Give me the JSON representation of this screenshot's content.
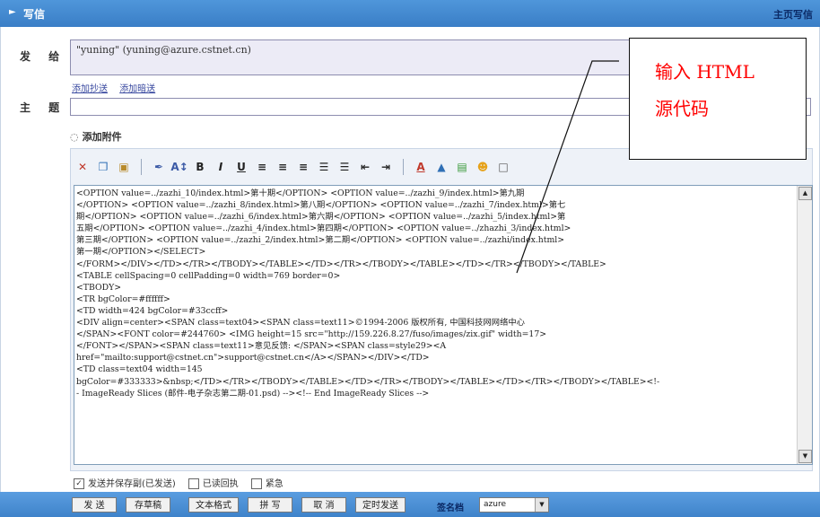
{
  "header": {
    "title": "写信",
    "back_link": "主页写信"
  },
  "compose": {
    "to_label": "发 给",
    "to_value": "\"yuning\" (yuning@azure.cstnet.cn)",
    "add_links": [
      "添加抄送",
      "添加暗送"
    ],
    "subject_label": "主 题",
    "subject_value": "",
    "attach_label": "添加附件"
  },
  "toolbar": {
    "icons": [
      "cut-icon",
      "copy-icon",
      "paste-icon",
      "font-icon",
      "font-size-icon",
      "bold-icon",
      "italic-icon",
      "underline-icon",
      "align-left-icon",
      "align-center-icon",
      "align-right-icon",
      "ordered-list-icon",
      "unordered-list-icon",
      "outdent-icon",
      "indent-icon",
      "text-color-icon",
      "bg-color-icon",
      "image-icon",
      "emotion-icon",
      "source-toggle-icon"
    ]
  },
  "source_code": [
    "<OPTION value=../zazhi_10/index.html>第十期</OPTION> <OPTION value=../zazhi_9/index.html>第九期",
    "</OPTION> <OPTION value=../zazhi_8/index.html>第八期</OPTION> <OPTION value=../zazhi_7/index.html>第七",
    "期</OPTION> <OPTION value=../zazhi_6/index.html>第六期</OPTION> <OPTION value=../zazhi_5/index.html>第",
    "五期</OPTION> <OPTION value=../zazhi_4/index.html>第四期</OPTION> <OPTION value=../zhazhi_3/index.html>",
    "第三期</OPTION> <OPTION value=../zazhi_2/index.html>第二期</OPTION> <OPTION value=../zazhi/index.html>",
    "第一期</OPTION></SELECT>",
    "</FORM></DIV></TD></TR></TBODY></TABLE></TD></TR></TBODY></TABLE></TD></TR></TBODY></TABLE>",
    "<TABLE cellSpacing=0 cellPadding=0 width=769 border=0>",
    "<TBODY>",
    "<TR bgColor=#ffffff>",
    "<TD width=424 bgColor=#33ccff>",
    "<DIV align=center><SPAN class=text04><SPAN class=text11>©1994-2006 版权所有, 中国科技网网络中心",
    "</SPAN><FONT color=#244760> <IMG height=15 src=\"http://159.226.8.27/fuso/images/zix.gif\" width=17>",
    "</FONT></SPAN><SPAN class=text11>意见反馈: </SPAN><SPAN class=style29><A",
    "href=\"mailto:support@cstnet.cn\">support@cstnet.cn</A></SPAN></DIV></TD>",
    "<TD class=text04 width=145",
    "bgColor=#333333>&nbsp;</TD></TR></TBODY></TABLE></TD></TR></TBODY></TABLE></TD></TR></TBODY></TABLE><!-",
    "- ImageReady Slices (邮件-电子杂志第二期-01.psd) --><!-- End ImageReady Slices -->"
  ],
  "options": {
    "save_sent": {
      "label": "发送并保存副(已发送)",
      "checked": true
    },
    "read_receipt": {
      "label": "已读回执",
      "checked": false
    },
    "urgent": {
      "label": "紧急",
      "checked": false
    }
  },
  "buttons": {
    "send": "发 送",
    "draft": "存草稿",
    "text_mode": "文本格式",
    "spell": "拼 写",
    "cancel": "取 消",
    "timed_send": "定时发送"
  },
  "signature": {
    "label": "签名档",
    "value": "azure"
  },
  "annotation": {
    "line1": "输入 HTML",
    "line2": "源代码"
  }
}
